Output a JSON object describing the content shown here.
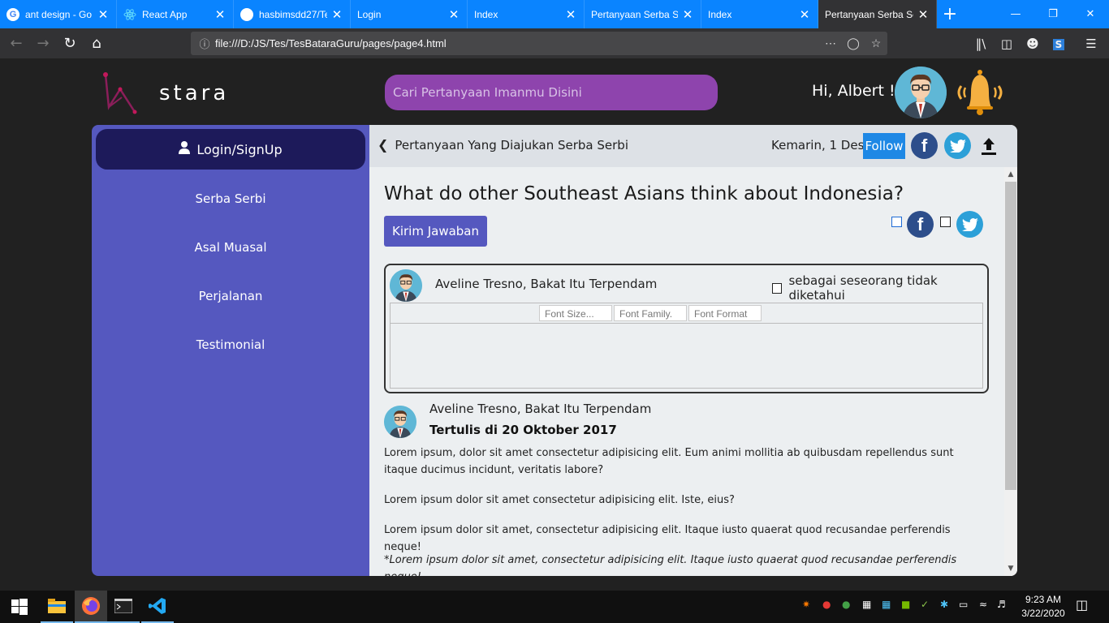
{
  "browser": {
    "tabs": [
      {
        "label": "ant design - Go",
        "icon": "google-icon",
        "color": "#ffffff"
      },
      {
        "label": "React App",
        "icon": "react-icon",
        "color": "#61dafb"
      },
      {
        "label": "hasbimsdd27/Te",
        "icon": "github-icon",
        "color": "#ffffff"
      },
      {
        "label": "Login",
        "icon": "",
        "color": ""
      },
      {
        "label": "Index",
        "icon": "",
        "color": ""
      },
      {
        "label": "Pertanyaan Serba Se",
        "icon": "",
        "color": ""
      },
      {
        "label": "Index",
        "icon": "",
        "color": ""
      },
      {
        "label": "Pertanyaan Serba Se",
        "icon": "",
        "color": "",
        "active": true
      }
    ],
    "url": "file:///D:/JS/Tes/TesBataraGuru/pages/page4.html"
  },
  "header": {
    "logo_text": "stara",
    "search_placeholder": "Cari Pertanyaan Imanmu Disini",
    "greeting": "Hi, Albert !"
  },
  "sidebar": {
    "login_label": "Login/SignUp",
    "items": [
      "Serba Serbi",
      "Asal Muasal",
      "Perjalanan",
      "Testimonial"
    ]
  },
  "content": {
    "back_label": "Pertanyaan Yang Diajukan Serba Serbi",
    "date": "Kemarin, 1 Des",
    "follow_label": "Follow",
    "question": "What do other Southeast Asians think about Indonesia?",
    "submit_label": "Kirim Jawaban",
    "answer_form": {
      "author": "Aveline Tresno, Bakat Itu Terpendam",
      "anonymous_label": "sebagai seseorang tidak diketahui",
      "toolbar": {
        "font_size": "Font Size...",
        "font_family": "Font Family.",
        "font_format": "Font Format"
      }
    },
    "answer": {
      "author": "Aveline Tresno, Bakat Itu Terpendam",
      "written": "Tertulis di 20 Oktober 2017",
      "paragraphs": [
        "Lorem ipsum, dolor sit amet consectetur adipisicing elit. Eum animi mollitia ab quibusdam repellendus sunt itaque ducimus incidunt, veritatis labore?",
        "Lorem ipsum dolor sit amet consectetur adipisicing elit. Iste, eius?",
        "Lorem ipsum dolor sit amet, consectetur adipisicing elit. Itaque iusto quaerat quod recusandae perferendis neque!",
        "*Lorem ipsum dolor sit amet, consectetur adipisicing elit. Itaque iusto quaerat quod recusandae perferendis neque!"
      ]
    }
  },
  "taskbar": {
    "time": "9:23 AM",
    "date": "3/22/2020"
  },
  "colors": {
    "sidebar": "#5558bf",
    "login_button": "#1d1a5a",
    "search": "#8e44ad",
    "follow": "#1e88e5",
    "browser_accent": "#0a84ff"
  }
}
